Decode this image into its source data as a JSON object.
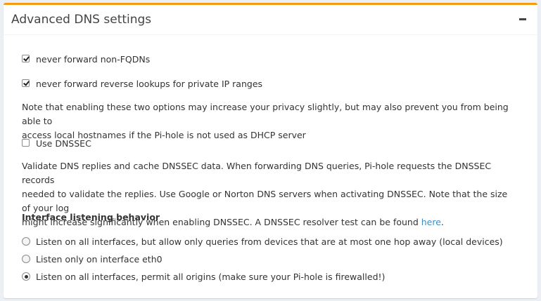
{
  "panel": {
    "title": "Advanced DNS settings"
  },
  "options": {
    "fqdn": {
      "label": "never forward non-FQDNs",
      "checked": true
    },
    "bogus_priv": {
      "label": "never forward reverse lookups for private IP ranges",
      "checked": true
    },
    "privacy_note_line1": "Note that enabling these two options may increase your privacy slightly, but may also prevent you from being able to",
    "privacy_note_line2": "access local hostnames if the Pi-hole is not used as DHCP server",
    "dnssec": {
      "label": "Use DNSSEC",
      "checked": false
    },
    "dnssec_note_line1": "Validate DNS replies and cache DNSSEC data. When forwarding DNS queries, Pi-hole requests the DNSSEC records",
    "dnssec_note_line2": "needed to validate the replies. Use Google or Norton DNS servers when activating DNSSEC. Note that the size of your log",
    "dnssec_note_line3": "might increase significantly when enabling DNSSEC. A DNSSEC resolver test can be found ",
    "dnssec_link": "here",
    "dnssec_note_end": "."
  },
  "interface": {
    "heading": "Interface listening behavior",
    "radios": [
      {
        "label": "Listen on all interfaces, but allow only queries from devices that are at most one hop away (local devices)",
        "checked": false
      },
      {
        "label": "Listen only on interface eth0",
        "checked": false
      },
      {
        "label": "Listen on all interfaces, permit all origins (make sure your Pi-hole is firewalled!)",
        "checked": true
      }
    ]
  },
  "colors": {
    "accent": "#f39c12",
    "link": "#3c8dbc"
  }
}
